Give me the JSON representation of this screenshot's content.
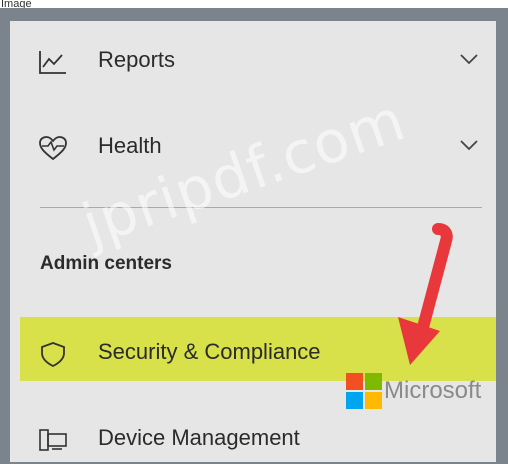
{
  "image_label": "Image",
  "nav": {
    "reports": {
      "label": "Reports",
      "icon": "line-chart-icon",
      "expanded": false
    },
    "health": {
      "label": "Health",
      "icon": "heart-pulse-icon",
      "expanded": false
    },
    "admin_title": "Admin centers",
    "security": {
      "label": "Security & Compliance",
      "icon": "shield-icon",
      "highlighted": true
    },
    "device": {
      "label": "Device Management",
      "icon": "device-icon"
    }
  },
  "overlays": {
    "watermark": "jpripdf.com",
    "brand": "Microsoft"
  },
  "colors": {
    "highlight": "#d8e04a",
    "arrow": "#e8383b",
    "panel": "#e6e6e6",
    "frame": "#7b848c"
  }
}
